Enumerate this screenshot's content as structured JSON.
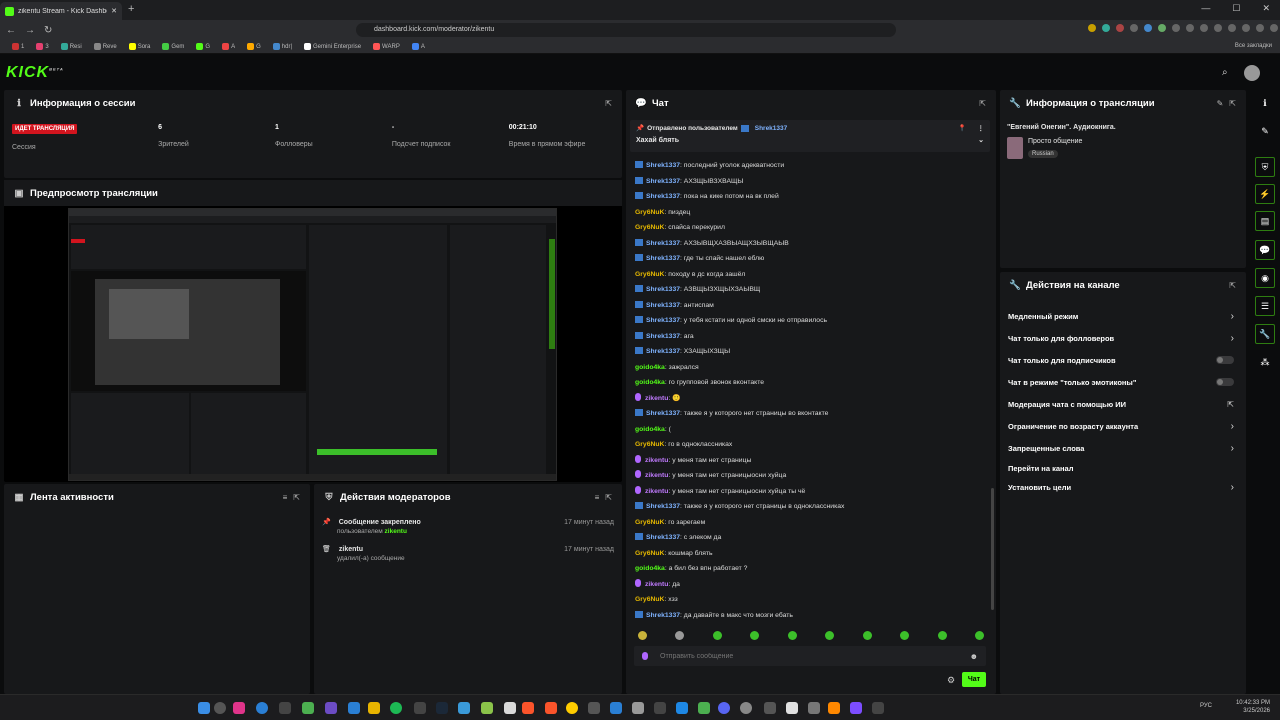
{
  "browser": {
    "tab_title": "zikentu Stream - Kick Dashbo",
    "url": "dashboard.kick.com/moderator/zikentu",
    "bookmarks": [
      "1",
      "3",
      "Resi",
      "Reve",
      "Sora",
      "Gem",
      "G",
      "A",
      "G",
      "hdr|",
      "Gemini Enterprise",
      "WARP",
      "A"
    ],
    "all_bookmarks": "Все закладки"
  },
  "session": {
    "title": "Информация о сессии",
    "live_badge": "ИДЕТ ТРАНСЛЯЦИЯ",
    "session_label": "Сессия",
    "viewers_value": "6",
    "viewers_label": "Зрителей",
    "followers_value": "1",
    "followers_label": "Фолловеры",
    "subs_value": "-",
    "subs_label": "Подсчет подписок",
    "uptime_value": "00:21:10",
    "uptime_label": "Время в прямом эфире"
  },
  "preview": {
    "title": "Предпросмотр трансляции"
  },
  "activity": {
    "title": "Лента активности"
  },
  "modactions": {
    "title": "Действия модераторов",
    "items": [
      {
        "title": "Сообщение закреплено",
        "sub_prefix": "пользователем",
        "sub_user": "zikentu",
        "time": "17 минут назад"
      },
      {
        "title": "zikentu",
        "sub_prefix": "удалил(-а) сообщение",
        "sub_user": "",
        "time": "17 минут назад"
      }
    ]
  },
  "chat": {
    "title": "Чат",
    "pinned_by_label": "Отправлено пользователем",
    "pinned_user": "Shrek1337",
    "pinned_text": "Хахай блять",
    "messages": [
      {
        "user": "Shrek1337",
        "color": "blue",
        "badge": true,
        "text": ": последний уголок адекватности"
      },
      {
        "user": "Shrek1337",
        "color": "blue",
        "badge": true,
        "text": ": АХЗЩЫВЗХВАЩЫ"
      },
      {
        "user": "Shrek1337",
        "color": "blue",
        "badge": true,
        "text": ": пока на кике потом на вк плей"
      },
      {
        "user": "Gry6NuK",
        "color": "orange",
        "badge": false,
        "text": ": пиздец"
      },
      {
        "user": "Gry6NuK",
        "color": "orange",
        "badge": false,
        "text": ": спайса перекурил"
      },
      {
        "user": "Shrek1337",
        "color": "blue",
        "badge": true,
        "text": ": АХЗЫВЩХАЗВЫАЩХЗЫВЩАЫВ"
      },
      {
        "user": "Shrek1337",
        "color": "blue",
        "badge": true,
        "text": ": где ты спайс нашел еблю"
      },
      {
        "user": "Gry6NuK",
        "color": "orange",
        "badge": false,
        "text": ": походу в дс когда зашёл"
      },
      {
        "user": "Shrek1337",
        "color": "blue",
        "badge": true,
        "text": ": АЗВЩЫЗХЩЫХЗАЫВЩ"
      },
      {
        "user": "Shrek1337",
        "color": "blue",
        "badge": true,
        "text": ": антиспам"
      },
      {
        "user": "Shrek1337",
        "color": "blue",
        "badge": true,
        "text": ": у тебя кстати ни одной смски не отправилось"
      },
      {
        "user": "Shrek1337",
        "color": "blue",
        "badge": true,
        "text": ": ага"
      },
      {
        "user": "Shrek1337",
        "color": "blue",
        "badge": true,
        "text": ": ХЗАЩЫХЗЩЫ"
      },
      {
        "user": "goido4ka",
        "color": "green",
        "badge": false,
        "text": ": зажрался"
      },
      {
        "user": "goido4ka",
        "color": "green",
        "badge": false,
        "text": ": го групповой звонок вконтакте"
      },
      {
        "user": "zikentu",
        "color": "purple",
        "badge": "p",
        "text": ": 🙂"
      },
      {
        "user": "Shrek1337",
        "color": "blue",
        "badge": true,
        "text": ": также я у которого нет страницы во вконтакте"
      },
      {
        "user": "goido4ka",
        "color": "green",
        "badge": false,
        "text": ": ("
      },
      {
        "user": "Gry6NuK",
        "color": "orange",
        "badge": false,
        "text": ": го в одноклассниках"
      },
      {
        "user": "zikentu",
        "color": "purple",
        "badge": "p",
        "text": ": у меня там нет страницы"
      },
      {
        "user": "zikentu",
        "color": "purple",
        "badge": "p",
        "text": ": у меня там нет страницыосни хуйца"
      },
      {
        "user": "zikentu",
        "color": "purple",
        "badge": "p",
        "text": ": у меня там нет страницыосни хуйца ты чё"
      },
      {
        "user": "Shrek1337",
        "color": "blue",
        "badge": true,
        "text": ": также я у которого нет страницы в одноклассниках"
      },
      {
        "user": "Gry6NuK",
        "color": "orange",
        "badge": false,
        "text": ": го зарегаем"
      },
      {
        "user": "Shrek1337",
        "color": "blue",
        "badge": true,
        "text": ": с элеком да"
      },
      {
        "user": "Gry6NuK",
        "color": "orange",
        "badge": false,
        "text": ": кошмар блять"
      },
      {
        "user": "goido4ka",
        "color": "green",
        "badge": false,
        "text": ": а бил без впн работает ?"
      },
      {
        "user": "zikentu",
        "color": "purple",
        "badge": "p",
        "text": ": да"
      },
      {
        "user": "Gry6NuK",
        "color": "orange",
        "badge": false,
        "text": ": хзз"
      },
      {
        "user": "Shrek1337",
        "color": "blue",
        "badge": true,
        "text": ": да давайте в макс что мозги ебать"
      }
    ],
    "input_placeholder": "Отправить сообщение",
    "send_label": "Чат"
  },
  "streaminfo": {
    "title": "Информация о трансляции",
    "stream_title": "\"Евгений Онегин\". Аудиокнига.",
    "category": "Просто общение",
    "language": "Russian"
  },
  "channelactions": {
    "title": "Действия на канале",
    "items": [
      {
        "label": "Медленный режим",
        "kind": "chev"
      },
      {
        "label": "Чат только для фолловеров",
        "kind": "chev"
      },
      {
        "label": "Чат только для подписчиков",
        "kind": "toggle"
      },
      {
        "label": "Чат в режиме \"только эмотиконы\"",
        "kind": "toggle"
      },
      {
        "label": "Модерация чата с помощью ИИ",
        "kind": "ext"
      },
      {
        "label": "Ограничение по возрасту аккаунта",
        "kind": "chev"
      },
      {
        "label": "Запрещенные слова",
        "kind": "chev"
      },
      {
        "label": "Перейти на канал",
        "kind": "none"
      },
      {
        "label": "Установить цели",
        "kind": "chev"
      }
    ]
  },
  "system": {
    "lang": "РУС",
    "time": "10:42:33 PM",
    "date": "3/25/2026"
  },
  "colors": {
    "accent": "#53fc18",
    "live": "#d2141e",
    "panel": "#17181a",
    "bg": "#0b0c0d"
  }
}
